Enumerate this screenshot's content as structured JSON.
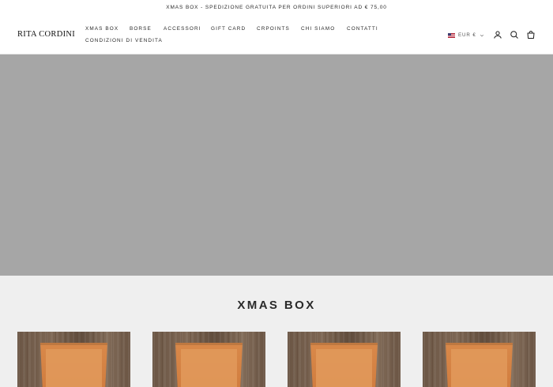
{
  "announcement": "XMAS BOX - SPEDIZIONE GRATUITA PER ORDINI SUPERIORI AD € 75,00",
  "header": {
    "logo": "RITA CORDINI",
    "nav": [
      {
        "label": "XMAS BOX"
      },
      {
        "label": "BORSE"
      },
      {
        "label": "ACCESSORI"
      },
      {
        "label": "GIFT CARD"
      },
      {
        "label": "CRPOINTS"
      },
      {
        "label": "CHI SIAMO"
      },
      {
        "label": "CONTATTI"
      },
      {
        "label": "CONDIZIONI DI VENDITA"
      }
    ],
    "currency": "EUR €",
    "icons": [
      "account-icon",
      "search-icon",
      "cart-icon"
    ]
  },
  "collection": {
    "title": "XMAS BOX",
    "products": [
      {},
      {},
      {},
      {}
    ]
  },
  "colors": {
    "hero": "#a6a6a6",
    "background": "#efefef",
    "box": "#d9894a"
  }
}
